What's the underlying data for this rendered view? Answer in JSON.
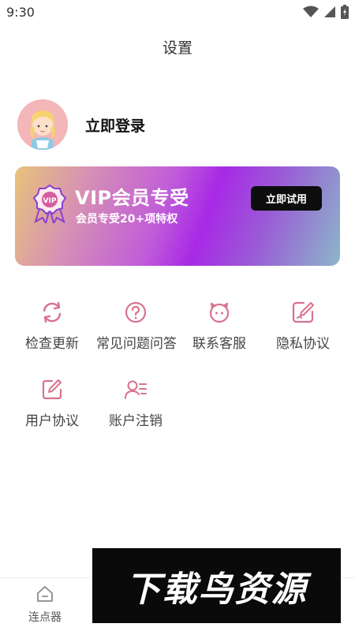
{
  "status_bar": {
    "time": "9:30",
    "icons": [
      "wifi-icon",
      "signal-icon",
      "battery-icon"
    ]
  },
  "header": {
    "title": "设置"
  },
  "profile": {
    "login_text": "立即登录"
  },
  "vip": {
    "title": "VIP会员专受",
    "subtitle": "会员专受20+项特权",
    "button_label": "立即试用",
    "badge_text": "VIP"
  },
  "menu": {
    "items": [
      {
        "label": "检查更新",
        "icon": "refresh-icon"
      },
      {
        "label": "常见问题问答",
        "icon": "question-icon"
      },
      {
        "label": "联系客服",
        "icon": "customer-service-icon"
      },
      {
        "label": "隐私协议",
        "icon": "privacy-edit-icon"
      },
      {
        "label": "用户协议",
        "icon": "user-agreement-icon"
      },
      {
        "label": "账户注销",
        "icon": "account-cancel-icon"
      }
    ]
  },
  "bottom_nav": {
    "items": [
      {
        "label": "连点器",
        "icon": "home-icon"
      }
    ]
  },
  "watermark": {
    "text": "下载鸟资源"
  },
  "colors": {
    "accent": "#d9728e",
    "vip_button": "#0d0d0d"
  }
}
